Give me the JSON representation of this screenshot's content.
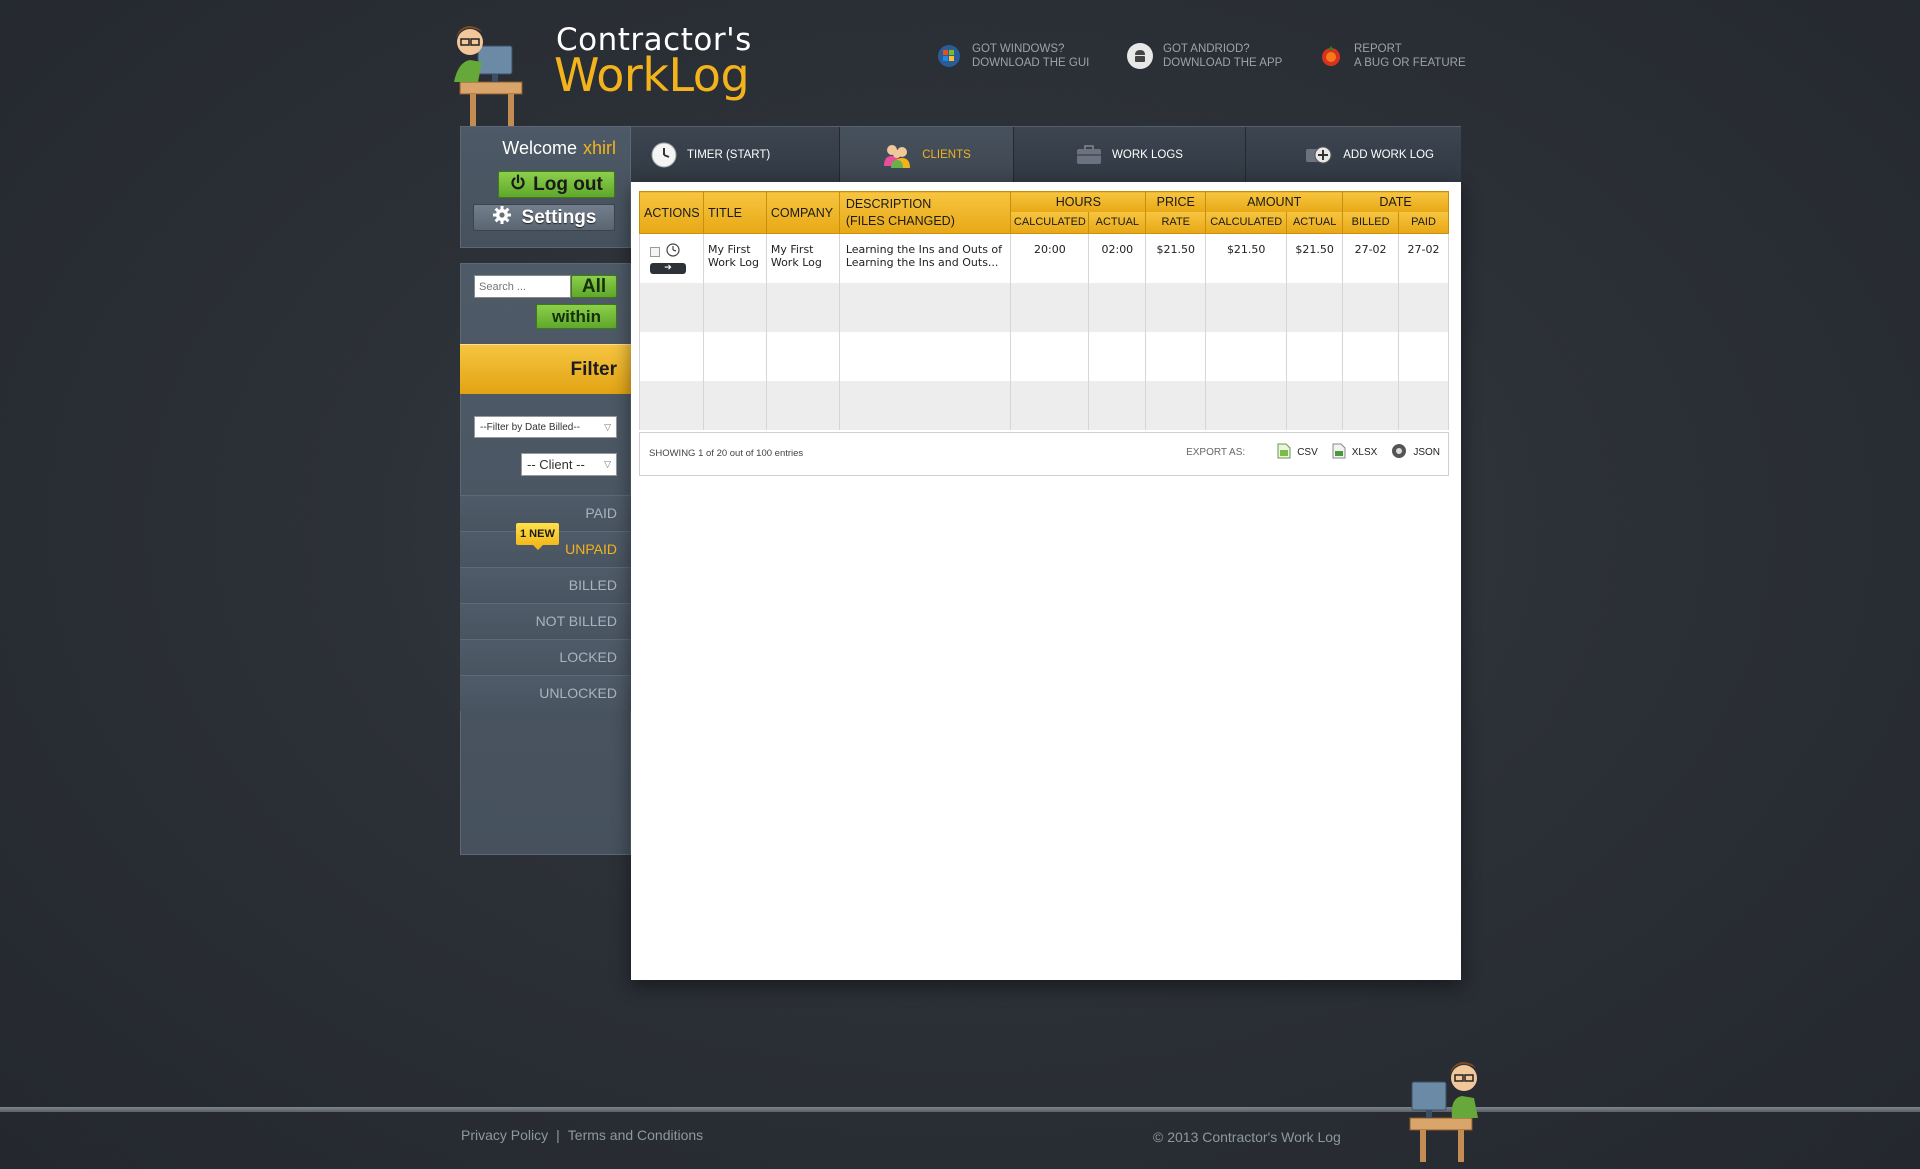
{
  "brand": {
    "line1": "Contractor's",
    "line2": "WorkLog"
  },
  "header_links": [
    {
      "icon": "windows-icon",
      "line1": "GOT WINDOWS?",
      "line2": "DOWNLOAD THE GUI"
    },
    {
      "icon": "android-icon",
      "line1": "GOT ANDRIOD?",
      "line2": "DOWNLOAD THE APP"
    },
    {
      "icon": "bug-icon",
      "line1": "REPORT",
      "line2": "A BUG OR FEATURE"
    }
  ],
  "user_panel": {
    "welcome": "Welcome",
    "username": "xhirl",
    "logout_label": "Log out",
    "settings_label": "Settings"
  },
  "search": {
    "placeholder": "Search ...",
    "all_label": "All",
    "within_label": "within"
  },
  "filter": {
    "title": "Filter",
    "date_select": "--Filter by Date Billed--",
    "client_select": "-- Client --",
    "items": [
      {
        "label": "PAID"
      },
      {
        "label": "UNPAID",
        "badge": "1 New"
      },
      {
        "label": "BILLED"
      },
      {
        "label": "NOT BILLED"
      },
      {
        "label": "LOCKED"
      },
      {
        "label": "UNLOCKED"
      }
    ]
  },
  "nav": {
    "tabs": [
      {
        "label": "TIMER (START)",
        "icon": "clock-icon"
      },
      {
        "label": "CLIENTS",
        "icon": "clients-icon"
      },
      {
        "label": "WORK LOGS",
        "icon": "briefcase-icon"
      },
      {
        "label": "ADD WORK LOG",
        "icon": "add-icon"
      }
    ]
  },
  "table": {
    "headers": {
      "actions": "ACTIONS",
      "title": "TITLE",
      "company": "COMPANY",
      "description_1": "DESCRIPTION",
      "description_2": "(FILES CHANGED)",
      "hours": "HOURS",
      "hours_calculated": "CALCULATED",
      "hours_actual": "ACTUAL",
      "price": "PRICE",
      "price_rate": "RATE",
      "amount": "AMOUNT",
      "amount_calculated": "CALCULATED",
      "amount_actual": "ACTUAL",
      "date": "DATE",
      "date_billed": "BILLED",
      "date_paid": "PAID"
    },
    "rows": [
      {
        "title": "My First Work Log",
        "company": "My First Work Log",
        "description": "Learning the Ins and Outs of Learning the Ins and Outs...",
        "hours_calculated": "20:00",
        "hours_actual": "02:00",
        "rate": "$21.50",
        "amount_calculated": "$21.50",
        "amount_actual": "$21.50",
        "billed": "27-02",
        "paid": "27-02"
      }
    ],
    "showing": "SHOWING 1 of 20 out of 100 entries",
    "export_label": "EXPORT AS:",
    "export_options": [
      "CSV",
      "XLSX",
      "JSON"
    ]
  },
  "footer": {
    "privacy": "Privacy Policy",
    "separator": "|",
    "terms": "Terms and Conditions",
    "copyright": "© 2013 Contractor's Work Log"
  }
}
